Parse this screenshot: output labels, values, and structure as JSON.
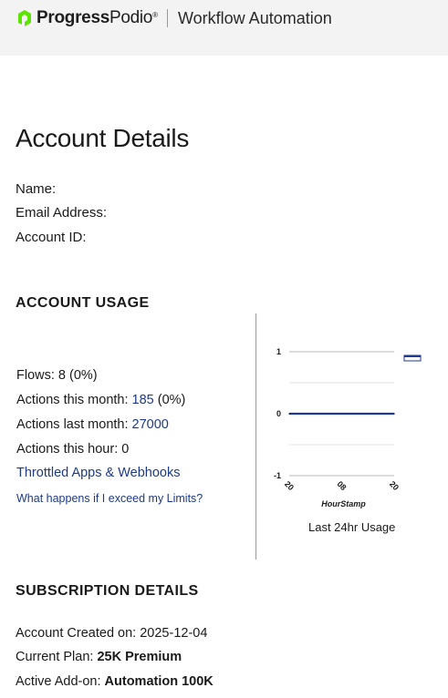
{
  "header": {
    "brand_name": "Progress",
    "brand_product": "Podio",
    "app_title": "Workflow Automation",
    "brand_color": "#5ce500"
  },
  "account": {
    "title": "Account Details",
    "name_label": "Name:",
    "email_label": "Email Address:",
    "id_label": "Account ID:"
  },
  "usage": {
    "heading": "ACCOUNT USAGE",
    "flows_label": "Flows: 8 (0%)",
    "actions_month_label": "Actions this month:",
    "actions_month_value": "185",
    "actions_month_pct": "(0%)",
    "actions_last_month_label": "Actions last month:",
    "actions_last_month_value": "27000",
    "actions_hour_label": "Actions this hour: 0",
    "throttled_link": "Throttled Apps & Webhooks",
    "limits_link": "What happens if I exceed my Limits?"
  },
  "chart_data": {
    "type": "line",
    "x": [
      "20",
      "08",
      "20"
    ],
    "series": [
      {
        "values": [
          0,
          0,
          0
        ],
        "color": "#1f3a93"
      }
    ],
    "title": "",
    "xlabel": "HourStamp",
    "ylabel": "",
    "ylim": [
      -1,
      1
    ],
    "yticks": [
      "1",
      "0",
      "-1"
    ],
    "grid": true,
    "legend": "right",
    "caption": "Last 24hr Usage"
  },
  "subscription": {
    "heading": "SUBSCRIPTION DETAILS",
    "created_label": "Account Created on:",
    "created_value": "2025-12-04",
    "plan_label": "Current Plan:",
    "plan_value": "25K Premium",
    "addon_label": "Active Add-on:",
    "addon_value": "Automation 100K"
  }
}
